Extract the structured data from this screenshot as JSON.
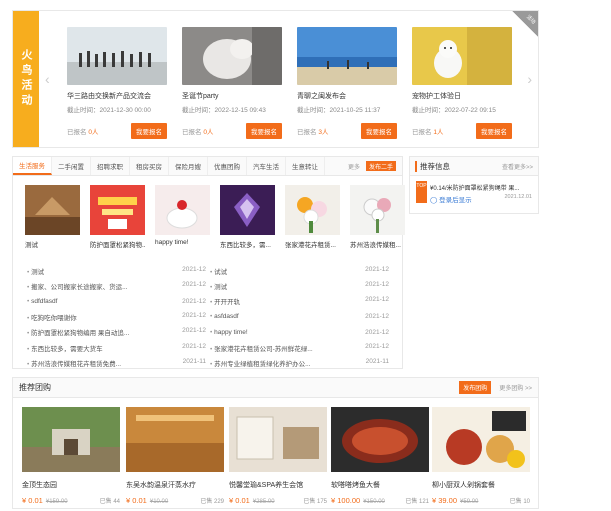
{
  "activity": {
    "label": "火鸟活动",
    "corner": "活动",
    "cards": [
      {
        "title": "华三路由交换新产品交流会",
        "time": "截止时间：2021-12-30 00:00",
        "count_prefix": "已报名",
        "count": "0人",
        "btn": "我要报名"
      },
      {
        "title": "圣诞节party",
        "time": "截止时间：2022-12-15 09:43",
        "count_prefix": "已报名",
        "count": "0人",
        "btn": "我要报名"
      },
      {
        "title": "青聊之闽发布会",
        "time": "截止时间：2021-10-25 11:37",
        "count_prefix": "已报名",
        "count": "3人",
        "btn": "我要报名"
      },
      {
        "title": "宠物护工体验日",
        "time": "截止时间：2022-07-22 09:15",
        "count_prefix": "已报名",
        "count": "1人",
        "btn": "我要报名"
      }
    ]
  },
  "life": {
    "tabs": [
      "生活服务",
      "二手闲置",
      "招聘求职",
      "租房买房",
      "保险月嫂",
      "优惠团购",
      "汽车生活",
      "生意转让"
    ],
    "more": "更多",
    "publish": "发布二手",
    "thumbs": [
      "测试",
      "防护面罩松紧狗物...",
      "happy time!",
      "东西比较多，需...",
      "张家港花卉租赁...",
      "苏州浩浪传媒租..."
    ],
    "posts": [
      [
        {
          "t": "测试",
          "d": "2021-12"
        },
        {
          "t": "试试",
          "d": "2021-12"
        }
      ],
      [
        {
          "t": "搬家、公司搬家长途搬家、货运...",
          "d": "2021-12"
        },
        {
          "t": "测试",
          "d": "2021-12"
        }
      ],
      [
        {
          "t": "sdfdfasdf",
          "d": "2021-12"
        },
        {
          "t": "开开开轨",
          "d": "2021-12"
        }
      ],
      [
        {
          "t": "吃狗吃你喂谢你",
          "d": "2021-12"
        },
        {
          "t": "asfdasdf",
          "d": "2021-12"
        }
      ],
      [
        {
          "t": "防护面罩松紧狗物编用 果自动追...",
          "d": "2021-12"
        },
        {
          "t": "happy time!",
          "d": "2021-12"
        }
      ],
      [
        {
          "t": "东西比较多，需要大货车",
          "d": "2021-12"
        },
        {
          "t": "张家港花卉租赁公司-苏州鲜花绿...",
          "d": "2021-12"
        }
      ],
      [
        {
          "t": "苏州浩浪传媒租花卉租赁免费...",
          "d": "2021-11"
        },
        {
          "t": "苏州专业绿植租赁绿化养护办公...",
          "d": "2021-11"
        }
      ]
    ]
  },
  "recommend": {
    "title": "推荐信息",
    "more": "查看更多>>",
    "top": "TOP",
    "item": "¥0.14/米防护面罩松紧狗绳带 果...",
    "login": "登录后显示",
    "date": "2021.12.01"
  },
  "group": {
    "title": "推荐团购",
    "publish": "发布团购",
    "more": "更多团购 >>",
    "cards": [
      {
        "title": "金顶生态园",
        "price": "¥ 0.01",
        "orig": "¥159.00",
        "sold": "已售 44"
      },
      {
        "title": "东吴水韵温泉汗蒸水疗",
        "price": "¥ 0.01",
        "orig": "¥10.00",
        "sold": "已售 229"
      },
      {
        "title": "悦馨堂瑜&SPA养生会馆",
        "price": "¥ 0.01",
        "orig": "¥285.00",
        "sold": "已售 175"
      },
      {
        "title": "软嗒嗒烤鱼大餐",
        "price": "¥ 100.00",
        "orig": "¥150.00",
        "sold": "已售 121"
      },
      {
        "title": "柳小厨双人剁锅套餐",
        "price": "¥ 39.00",
        "orig": "¥59.00",
        "sold": "已售 10"
      }
    ]
  }
}
